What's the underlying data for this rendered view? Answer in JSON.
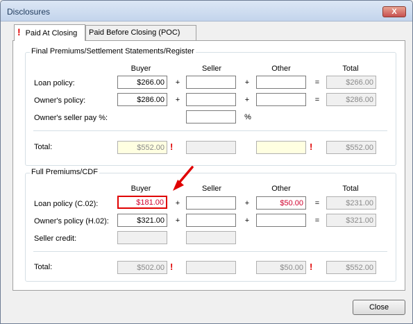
{
  "window": {
    "title": "Disclosures",
    "close_glyph": "X"
  },
  "tabs": [
    {
      "label": "Paid At Closing",
      "warning_glyph": "!"
    },
    {
      "label": "Paid Before Closing (POC)"
    }
  ],
  "final_section": {
    "title": "Final Premiums/Settlement Statements/Register",
    "headers": {
      "buyer": "Buyer",
      "seller": "Seller",
      "other": "Other",
      "total": "Total"
    },
    "rows": [
      {
        "label": "Loan policy:",
        "buyer": "$266.00",
        "seller": "",
        "other": "",
        "total": "$266.00"
      },
      {
        "label": "Owner's policy:",
        "buyer": "$286.00",
        "seller": "",
        "other": "",
        "total": "$286.00"
      }
    ],
    "seller_pay": {
      "label": "Owner's seller pay %:",
      "value": "",
      "unit": "%"
    },
    "total_row": {
      "label": "Total:",
      "buyer": "$552.00",
      "seller": "",
      "other": "",
      "total": "$552.00"
    }
  },
  "full_section": {
    "title": "Full Premiums/CDF",
    "headers": {
      "buyer": "Buyer",
      "seller": "Seller",
      "other": "Other",
      "total": "Total"
    },
    "rows": [
      {
        "label": "Loan policy (C.02):",
        "buyer": "$181.00",
        "seller": "",
        "other": "$50.00",
        "total": "$231.00"
      },
      {
        "label": "Owner's policy (H.02):",
        "buyer": "$321.00",
        "seller": "",
        "other": "",
        "total": "$321.00"
      }
    ],
    "seller_credit": {
      "label": "Seller credit:",
      "buyer": "",
      "seller": ""
    },
    "total_row": {
      "label": "Total:",
      "buyer": "$502.00",
      "seller": "",
      "other": "$50.00",
      "total": "$552.00"
    }
  },
  "operators": {
    "plus": "+",
    "equals": "="
  },
  "warning_glyph": "!",
  "buttons": {
    "close": "Close"
  },
  "colors": {
    "warning": "#e00000",
    "highlight_border": "#e00000"
  }
}
